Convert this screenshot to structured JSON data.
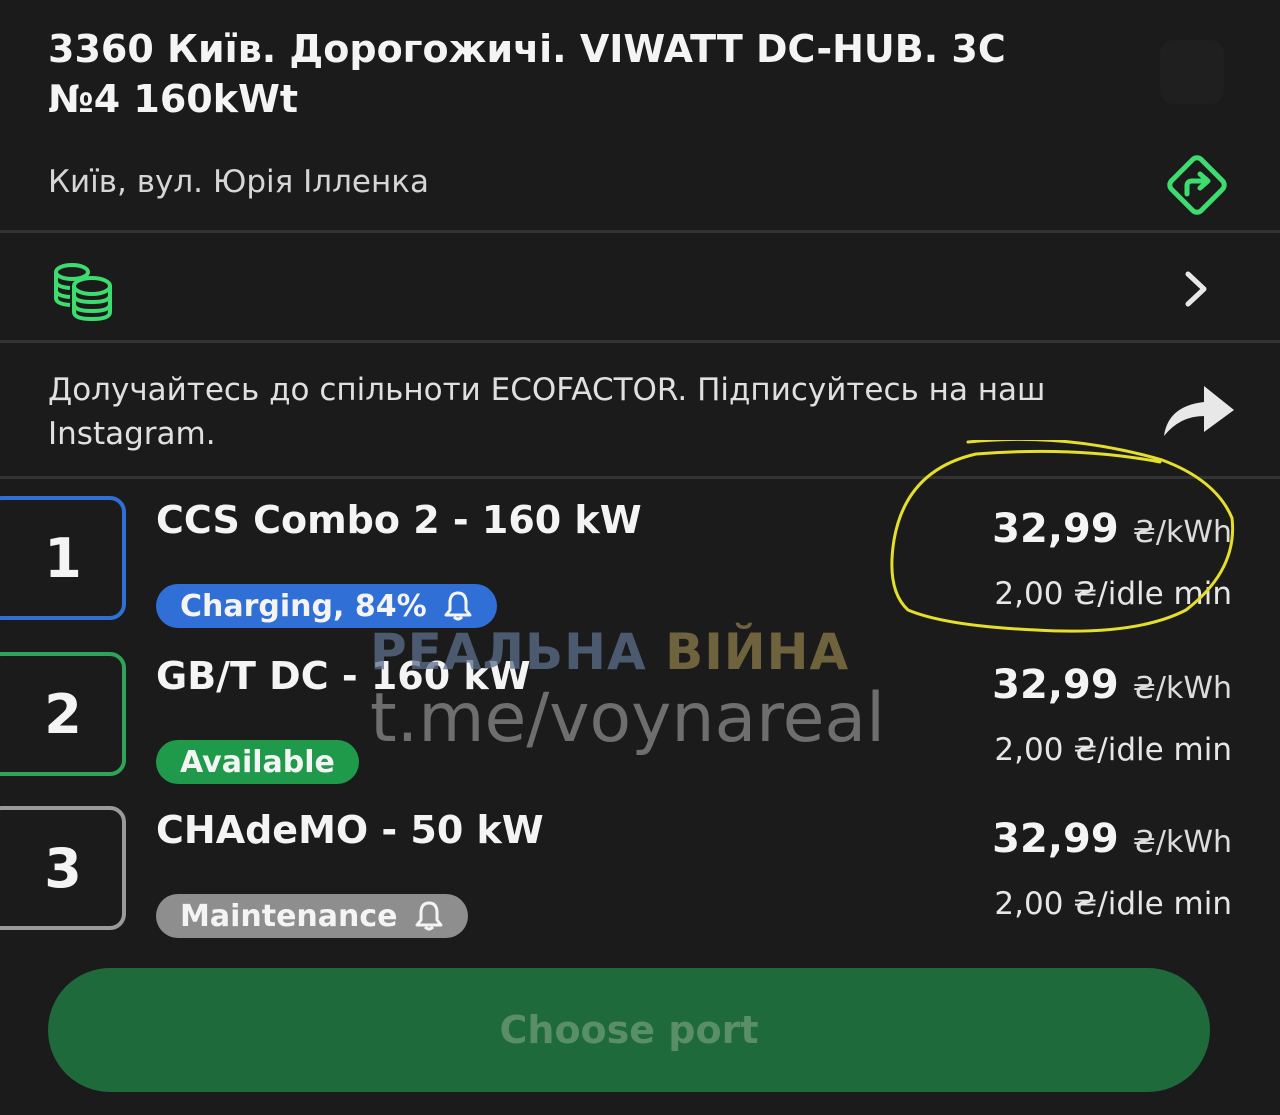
{
  "station": {
    "title": "3360 Київ. Дорогожичі. VIWATT DC-HUB. 3C\n№4 160kWt",
    "address": "Київ, вул. Юрія Ілленка"
  },
  "promo": {
    "text": "Долучайтесь до спільноти ECOFACTOR. Підписуйтесь на наш Instagram."
  },
  "ports": [
    {
      "number": "1",
      "name": "CCS Combo 2 - 160 kW",
      "status": "Charging, 84%",
      "status_color": "#2f6fd6",
      "border_color": "#2f6fd6",
      "has_bell": true,
      "price": "32,99",
      "price_unit": "₴/kWh",
      "idle": "2,00 ₴/idle min"
    },
    {
      "number": "2",
      "name": "GB/T DC - 160 kW",
      "status": "Available",
      "status_color": "#1f9a4a",
      "border_color": "#2fa35a",
      "has_bell": false,
      "price": "32,99",
      "price_unit": "₴/kWh",
      "idle": "2,00 ₴/idle min"
    },
    {
      "number": "3",
      "name": "CHAdeMO - 50 kW",
      "status": "Maintenance",
      "status_color": "#8e8e8e",
      "border_color": "#9a9a9a",
      "has_bell": true,
      "price": "32,99",
      "price_unit": "₴/kWh",
      "idle": "2,00 ₴/idle min"
    }
  ],
  "watermark": {
    "line1_a": "РЕАЛЬНА ",
    "line1_b": "ВІЙНА",
    "line2": "t.me/voynareal"
  },
  "action": {
    "label": "Choose port"
  },
  "colors": {
    "accent_green": "#3ddc6e",
    "annotation_yellow": "#e3df2a"
  }
}
